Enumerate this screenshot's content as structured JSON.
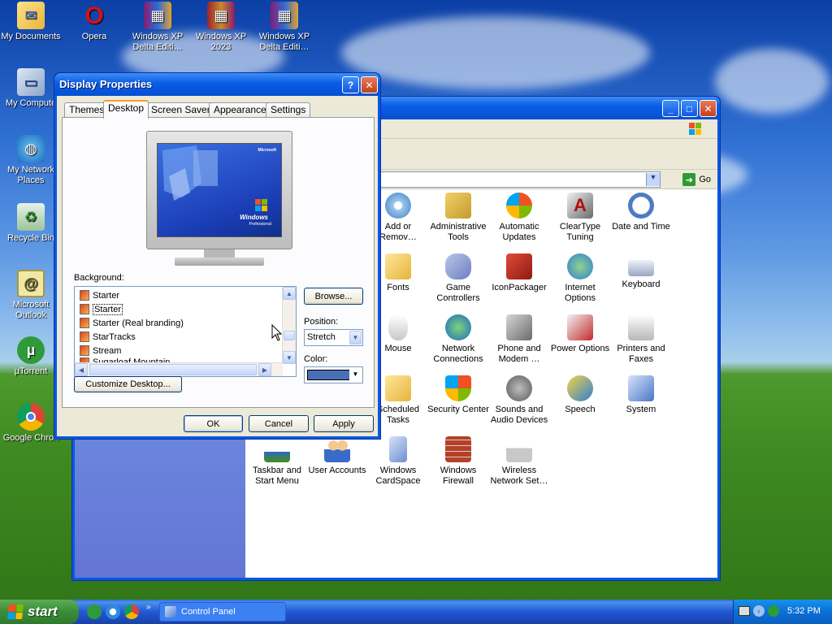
{
  "desktop": {
    "icons": [
      {
        "label": "My Documents",
        "icon": "folder-documents-icon"
      },
      {
        "label": "Opera",
        "icon": "opera-icon"
      },
      {
        "label": "Windows XP Delta Editi…",
        "icon": "winrar-archive-icon"
      },
      {
        "label": "Windows XP 2023",
        "icon": "winrar-archive-icon"
      },
      {
        "label": "Windows XP Delta Editi…",
        "icon": "winrar-archive-icon"
      },
      {
        "label": "My Compute",
        "icon": "my-computer-icon"
      },
      {
        "label": "My Network Places",
        "icon": "network-places-icon"
      },
      {
        "label": "Recycle Bin",
        "icon": "recycle-bin-icon"
      },
      {
        "label": "Microsoft Outlook",
        "icon": "outlook-icon"
      },
      {
        "label": "µTorrent",
        "icon": "utorrent-icon"
      },
      {
        "label": "Google Chron",
        "icon": "chrome-icon"
      }
    ]
  },
  "control_panel": {
    "address_go": "Go",
    "items": [
      {
        "label": "Add or Remov…",
        "icon": "add-remove-programs-icon"
      },
      {
        "label": "Administrative Tools",
        "icon": "administrative-tools-icon"
      },
      {
        "label": "Automatic Updates",
        "icon": "automatic-updates-icon"
      },
      {
        "label": "ClearType Tuning",
        "icon": "cleartype-icon"
      },
      {
        "label": "Date and Time",
        "icon": "date-time-icon"
      },
      {
        "label": "Fonts",
        "icon": "fonts-folder-icon"
      },
      {
        "label": "Game Controllers",
        "icon": "game-controller-icon"
      },
      {
        "label": "IconPackager",
        "icon": "iconpackager-icon"
      },
      {
        "label": "Internet Options",
        "icon": "internet-options-icon"
      },
      {
        "label": "Keyboard",
        "icon": "keyboard-icon"
      },
      {
        "label": "Mouse",
        "icon": "mouse-icon"
      },
      {
        "label": "Network Connections",
        "icon": "network-connections-icon"
      },
      {
        "label": "Phone and Modem …",
        "icon": "phone-modem-icon"
      },
      {
        "label": "Power Options",
        "icon": "power-options-icon"
      },
      {
        "label": "Printers and Faxes",
        "icon": "printer-icon"
      },
      {
        "label": "Scheduled Tasks",
        "icon": "scheduled-tasks-icon"
      },
      {
        "label": "Security Center",
        "icon": "security-shield-icon"
      },
      {
        "label": "Sounds and Audio Devices",
        "icon": "speaker-icon"
      },
      {
        "label": "Speech",
        "icon": "speech-icon"
      },
      {
        "label": "System",
        "icon": "system-icon"
      },
      {
        "label": "Taskbar and Start Menu",
        "icon": "taskbar-icon"
      },
      {
        "label": "User Accounts",
        "icon": "user-accounts-icon"
      },
      {
        "label": "Windows CardSpace",
        "icon": "cardspace-icon"
      },
      {
        "label": "Windows Firewall",
        "icon": "firewall-icon"
      },
      {
        "label": "Wireless Network Set…",
        "icon": "wireless-network-icon"
      }
    ]
  },
  "dialog": {
    "title": "Display Properties",
    "tabs": [
      "Themes",
      "Desktop",
      "Screen Saver",
      "Appearance",
      "Settings"
    ],
    "active_tab": "Desktop",
    "background_label": "Background:",
    "background_items": [
      "Starter",
      "Starter",
      "Starter (Real branding)",
      "StarTracks",
      "Stream",
      "Sugarloaf Mountain"
    ],
    "selected_index": 1,
    "browse_label": "Browse...",
    "position_label": "Position:",
    "position_value": "Stretch",
    "color_label": "Color:",
    "color_value": "#4a6fb5",
    "customize_label": "Customize Desktop...",
    "ok_label": "OK",
    "cancel_label": "Cancel",
    "apply_label": "Apply",
    "preview_logo": "Windows",
    "preview_logo_sub": "Professional",
    "preview_brand": "Microsoft"
  },
  "taskbar": {
    "start_label": "start",
    "task_label": "Control Panel",
    "clock": "5:32 PM",
    "quick_launch": [
      "utorrent-icon",
      "internet-explorer-icon",
      "chrome-icon"
    ]
  },
  "colors": {
    "xp_blue": "#0a58e0",
    "start_green": "#3c8f3b",
    "dialog_face": "#ece9d8"
  }
}
